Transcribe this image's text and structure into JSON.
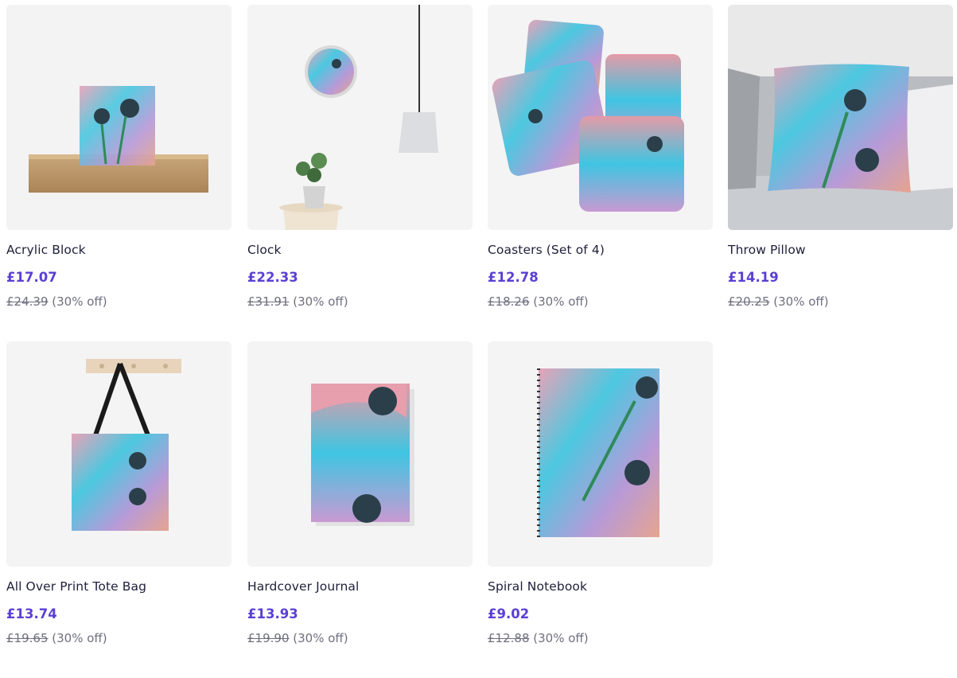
{
  "products": [
    {
      "title": "Acrylic Block",
      "price": "£17.07",
      "was": "£24.39",
      "discount": "(30% off)",
      "icon": "acrylic-block-image"
    },
    {
      "title": "Clock",
      "price": "£22.33",
      "was": "£31.91",
      "discount": "(30% off)",
      "icon": "clock-image"
    },
    {
      "title": "Coasters (Set of 4)",
      "price": "£12.78",
      "was": "£18.26",
      "discount": "(30% off)",
      "icon": "coasters-image"
    },
    {
      "title": "Throw Pillow",
      "price": "£14.19",
      "was": "£20.25",
      "discount": "(30% off)",
      "icon": "throw-pillow-image"
    },
    {
      "title": "All Over Print Tote Bag",
      "price": "£13.74",
      "was": "£19.65",
      "discount": "(30% off)",
      "icon": "tote-bag-image"
    },
    {
      "title": "Hardcover Journal",
      "price": "£13.93",
      "was": "£19.90",
      "discount": "(30% off)",
      "icon": "journal-image"
    },
    {
      "title": "Spiral Notebook",
      "price": "£9.02",
      "was": "£12.88",
      "discount": "(30% off)",
      "icon": "notebook-image"
    }
  ],
  "colors": {
    "price": "#5b3fd6",
    "title": "#1f1f3a",
    "muted": "#6f6f80"
  }
}
